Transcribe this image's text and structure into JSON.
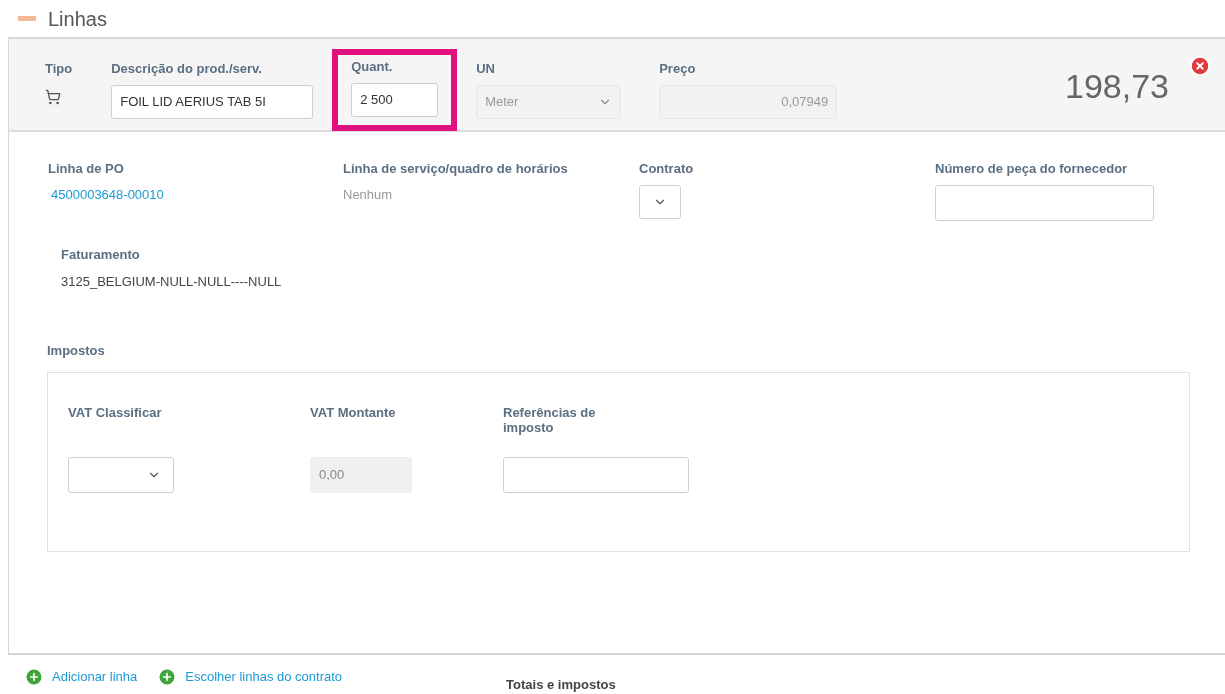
{
  "section_title": "Linhas",
  "line_header": {
    "type_label": "Tipo",
    "fields": [
      {
        "kind": "input",
        "label": "Descrição do prod./serv.",
        "value": "FOIL LID AERIUS TAB 5I",
        "disabled": false,
        "highlighted": false
      },
      {
        "kind": "input",
        "label": "Quant.",
        "value": "2 500",
        "disabled": false,
        "highlighted": true
      },
      {
        "kind": "select",
        "label": "UN",
        "value": "Meter",
        "disabled": true,
        "highlighted": false
      },
      {
        "kind": "input",
        "label": "Preço",
        "value": "0,07949",
        "disabled": true,
        "highlighted": false
      }
    ],
    "total": "198,73"
  },
  "details": [
    {
      "kind": "link",
      "label": "Linha de PO",
      "value": "4500003648-00010"
    },
    {
      "kind": "text",
      "label": "Linha de serviço/quadro de horários",
      "value": "Nenhum"
    },
    {
      "kind": "select",
      "label": "Contrato"
    },
    {
      "kind": "input",
      "label": "Número de peça do fornecedor"
    }
  ],
  "billing": {
    "label": "Faturamento",
    "value": "3125_BELGIUM-NULL-NULL----NULL"
  },
  "taxes": {
    "label": "Impostos",
    "fields": [
      {
        "kind": "select",
        "label": "VAT Classificar"
      },
      {
        "kind": "input",
        "label": "VAT Montante",
        "value": "0,00",
        "disabled": true
      },
      {
        "kind": "input",
        "label": "Referências de imposto",
        "disabled": false
      }
    ]
  },
  "actions": [
    "Adicionar linha",
    "Escolher linhas do contrato"
  ],
  "totals_heading": "Totais e impostos"
}
